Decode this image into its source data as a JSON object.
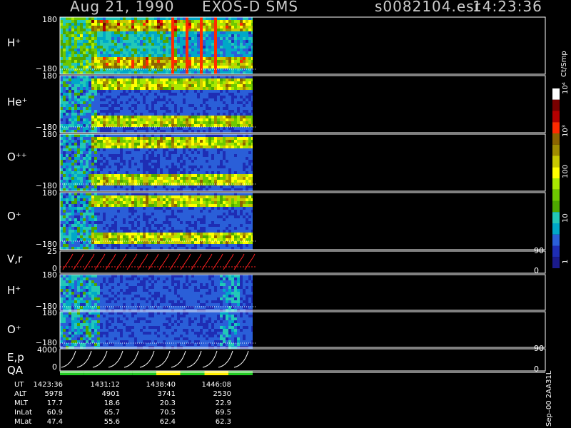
{
  "header": {
    "date": "Aug 21, 1990",
    "mission": "EXOS-D SMS",
    "file": "s0082104.esr",
    "time": "14:23:36"
  },
  "colors": {
    "background": "#000000",
    "text": "#ffffff",
    "panel_border": "#ffffff",
    "velocity_trace": "#ff2020",
    "energy_trace": "#ffffff",
    "qa_good": "#22cc22",
    "qa_warn": "#ffee00"
  },
  "colorbar": {
    "unit": "Ct/Smp",
    "ticks": [
      "1",
      "10",
      "100",
      "10³",
      "10⁴"
    ],
    "colors": [
      "#1a1a8c",
      "#1e2db4",
      "#2a5fd8",
      "#00a8c8",
      "#22c8b8",
      "#4ea800",
      "#6ec800",
      "#a8e800",
      "#ffff00",
      "#c8c800",
      "#a08c00",
      "#8c6400",
      "#ff2a00",
      "#b40000",
      "#780000",
      "#ffffff"
    ]
  },
  "panels": {
    "h_plus": {
      "label": "H⁺",
      "ytop": "180",
      "ybottom": "−180"
    },
    "he_plus": {
      "label": "He⁺",
      "ytop": "180",
      "ybottom": "−180"
    },
    "o_plus_plus": {
      "label": "O⁺⁺",
      "ytop": "180",
      "ybottom": "−180"
    },
    "o_plus": {
      "label": "O⁺",
      "ytop": "180",
      "ybottom": "−180"
    },
    "v_r": {
      "label": "V,r",
      "ytop": "25",
      "ybottom": "0",
      "right_top": "90",
      "right_bottom": "0"
    },
    "h_plus_2": {
      "label": "H⁺",
      "ytop": "180",
      "ybottom": "−180"
    },
    "o_plus_2": {
      "label": "O⁺",
      "ytop": "180",
      "ybottom": "−180"
    },
    "e_p": {
      "label": "E,p",
      "ytop": "4000",
      "ybottom": "0",
      "right_top": "90",
      "right_bottom": "0"
    },
    "qa": {
      "label": "QA"
    }
  },
  "footer": {
    "row_labels": [
      "UT",
      "ALT",
      "MLT",
      "InLat",
      "MLat"
    ],
    "columns": [
      [
        "1423:36",
        "5978",
        "17.7",
        "60.9",
        "47.4"
      ],
      [
        "1431:12",
        "4901",
        "18.6",
        "65.7",
        "55.6"
      ],
      [
        "1438:40",
        "3741",
        "20.3",
        "70.5",
        "62.4"
      ],
      [
        "1446:08",
        "2530",
        "22.9",
        "69.5",
        "62.3"
      ]
    ],
    "version": "Sep–00  2AA31L"
  },
  "chart_data": {
    "type": "heatmap",
    "title": "Aug 21, 1990   EXOS-D SMS",
    "time_ticks": [
      "1423:36",
      "1431:12",
      "1438:40",
      "1446:08"
    ],
    "colorbar": {
      "label": "Ct/Smp",
      "ticks": [
        "1",
        "10",
        "100",
        "10³",
        "10⁴"
      ],
      "scale": "log"
    },
    "panels": [
      {
        "name": "H⁺",
        "ylim": [
          -180,
          180
        ]
      },
      {
        "name": "He⁺",
        "ylim": [
          -180,
          180
        ]
      },
      {
        "name": "O⁺⁺",
        "ylim": [
          -180,
          180
        ]
      },
      {
        "name": "O⁺",
        "ylim": [
          -180,
          180
        ]
      },
      {
        "name": "V,r",
        "ylim": [
          0,
          25
        ],
        "right_axis": [
          0,
          90
        ],
        "type": "line"
      },
      {
        "name": "H⁺",
        "ylim": [
          -180,
          180
        ]
      },
      {
        "name": "O⁺",
        "ylim": [
          -180,
          180
        ]
      },
      {
        "name": "E,p",
        "ylim": [
          0,
          4000
        ],
        "right_axis": [
          0,
          90
        ],
        "type": "line"
      },
      {
        "name": "QA",
        "type": "status",
        "segments": [
          "good",
          "good",
          "good",
          "good",
          "warn",
          "good",
          "warn",
          "good"
        ]
      }
    ]
  }
}
